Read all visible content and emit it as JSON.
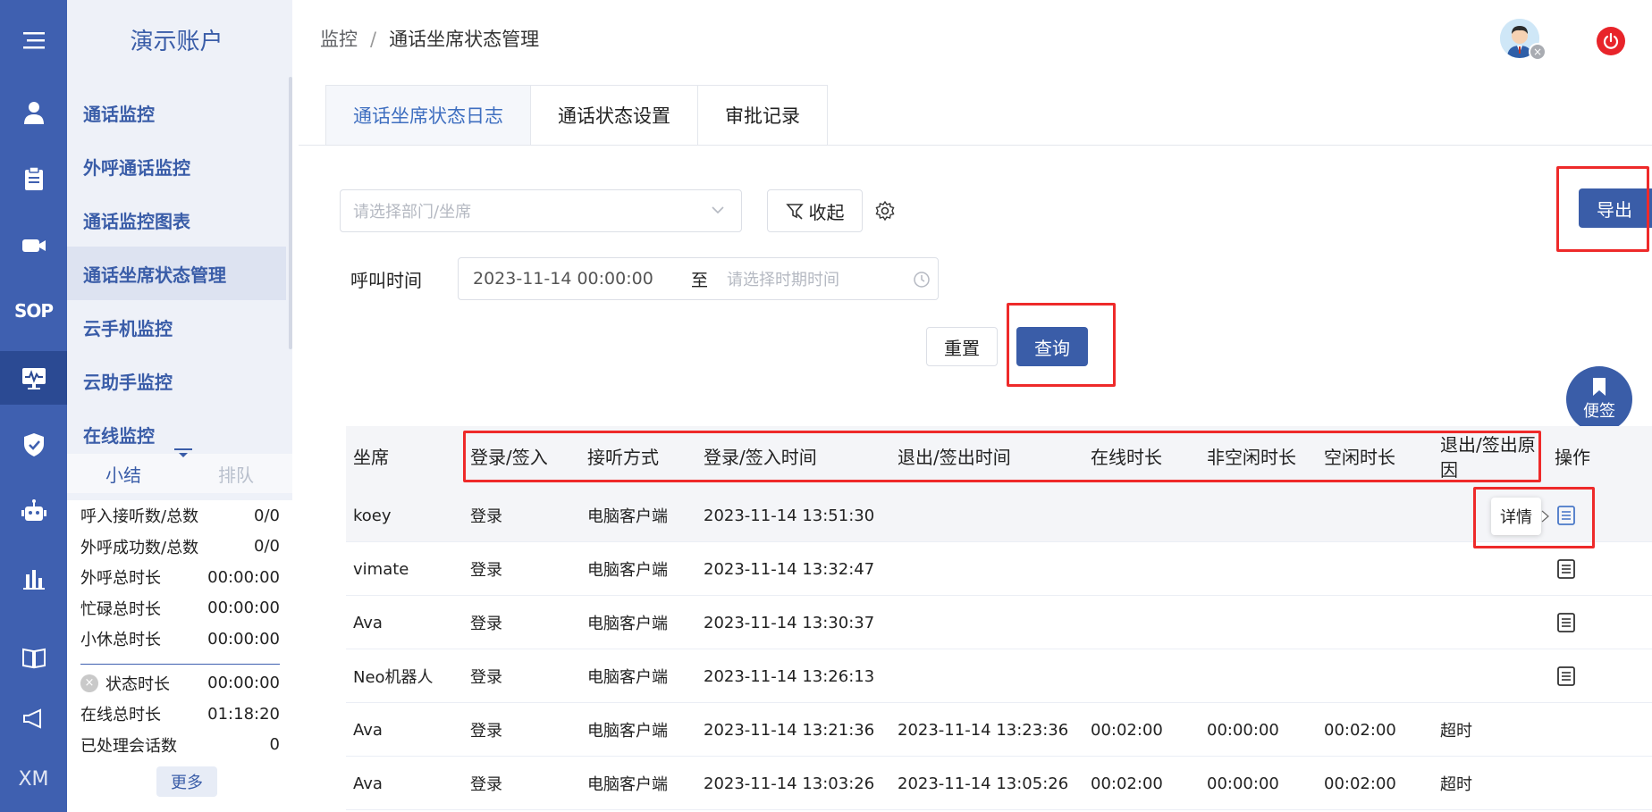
{
  "rail": {
    "sop_label": "SOP",
    "xm_label": "XM"
  },
  "sidebar": {
    "account_name": "演示账户",
    "menu": [
      "通话监控",
      "外呼通话监控",
      "通话监控图表",
      "通话坐席状态管理",
      "云手机监控",
      "云助手监控",
      "在线监控"
    ],
    "tab_summary": "小结",
    "tab_queue": "排队",
    "stats": [
      {
        "label": "呼入接听数/总数",
        "value": "0/0"
      },
      {
        "label": "外呼成功数/总数",
        "value": "0/0"
      },
      {
        "label": "外呼总时长",
        "value": "00:00:00"
      },
      {
        "label": "忙碌总时长",
        "value": "00:00:00"
      },
      {
        "label": "小休总时长",
        "value": "00:00:00"
      }
    ],
    "stats2": [
      {
        "label": "状态时长",
        "value": "00:00:00"
      },
      {
        "label": "在线总时长",
        "value": "01:18:20"
      },
      {
        "label": "已处理会话数",
        "value": "0"
      }
    ],
    "more_label": "更多"
  },
  "breadcrumb": {
    "root": "监控",
    "separator": "/",
    "current": "通话坐席状态管理"
  },
  "tabs": [
    "通话坐席状态日志",
    "通话状态设置",
    "审批记录"
  ],
  "filters": {
    "dept_placeholder": "请选择部门/坐席",
    "collapse_label": "收起",
    "call_time_label": "呼叫时间",
    "date_start": "2023-11-14 00:00:00",
    "date_to": "至",
    "date_end_placeholder": "请选择时期时间",
    "reset_label": "重置",
    "query_label": "查询",
    "export_label": "导出"
  },
  "note_label": "便签",
  "table": {
    "headers": [
      "坐席",
      "登录/签入",
      "接听方式",
      "登录/签入时间",
      "退出/签出时间",
      "在线时长",
      "非空闲时长",
      "空闲时长",
      "退出/签出原因",
      "操作"
    ],
    "rows": [
      [
        "koey",
        "登录",
        "电脑客户端",
        "2023-11-14 13:51:30",
        "",
        "",
        "",
        "",
        ""
      ],
      [
        "vimate",
        "登录",
        "电脑客户端",
        "2023-11-14 13:32:47",
        "",
        "",
        "",
        "",
        ""
      ],
      [
        "Ava",
        "登录",
        "电脑客户端",
        "2023-11-14 13:30:37",
        "",
        "",
        "",
        "",
        ""
      ],
      [
        "Neo机器人",
        "登录",
        "电脑客户端",
        "2023-11-14 13:26:13",
        "",
        "",
        "",
        "",
        ""
      ],
      [
        "Ava",
        "登录",
        "电脑客户端",
        "2023-11-14 13:21:36",
        "2023-11-14 13:23:36",
        "00:02:00",
        "00:00:00",
        "00:02:00",
        "超时"
      ],
      [
        "Ava",
        "登录",
        "电脑客户端",
        "2023-11-14 13:03:26",
        "2023-11-14 13:05:26",
        "00:02:00",
        "00:00:00",
        "00:02:00",
        "超时"
      ]
    ],
    "tooltip": "详情"
  },
  "colors": {
    "brand": "#3f60b0",
    "annotation": "#ee2a2a",
    "power": "#e8242a"
  }
}
